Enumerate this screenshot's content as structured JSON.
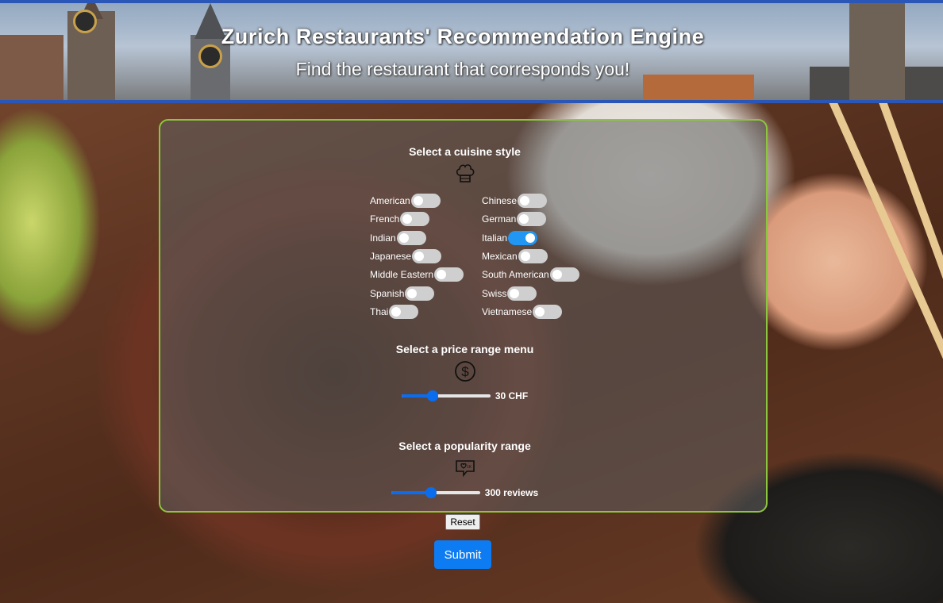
{
  "header": {
    "title": "Zurich Restaurants' Recommendation Engine",
    "subtitle": "Find the restaurant that corresponds you!"
  },
  "cuisine": {
    "title": "Select a cuisine style",
    "icon": "chef-hat-icon",
    "options": [
      {
        "label": "American",
        "on": false
      },
      {
        "label": "Chinese",
        "on": false
      },
      {
        "label": "French",
        "on": false
      },
      {
        "label": "German",
        "on": false
      },
      {
        "label": "Indian",
        "on": false
      },
      {
        "label": "Italian",
        "on": true
      },
      {
        "label": "Japanese",
        "on": false
      },
      {
        "label": "Mexican",
        "on": false
      },
      {
        "label": "Middle Eastern",
        "on": false
      },
      {
        "label": "South American",
        "on": false
      },
      {
        "label": "Spanish",
        "on": false
      },
      {
        "label": "Swiss",
        "on": false
      },
      {
        "label": "Thai",
        "on": false
      },
      {
        "label": "Vietnamese",
        "on": false
      }
    ]
  },
  "price": {
    "title": "Select a price range menu",
    "icon": "dollar-circle-icon",
    "value_label": "30 CHF",
    "fraction": 0.35
  },
  "popularity": {
    "title": "Select a popularity range",
    "icon": "heart-chat-icon",
    "value_label": "300 reviews",
    "fraction": 0.45
  },
  "buttons": {
    "reset": "Reset",
    "submit": "Submit"
  },
  "colors": {
    "accent": "#2196f3",
    "panel_border": "#8cc63f",
    "header_border": "#2a56b8"
  }
}
